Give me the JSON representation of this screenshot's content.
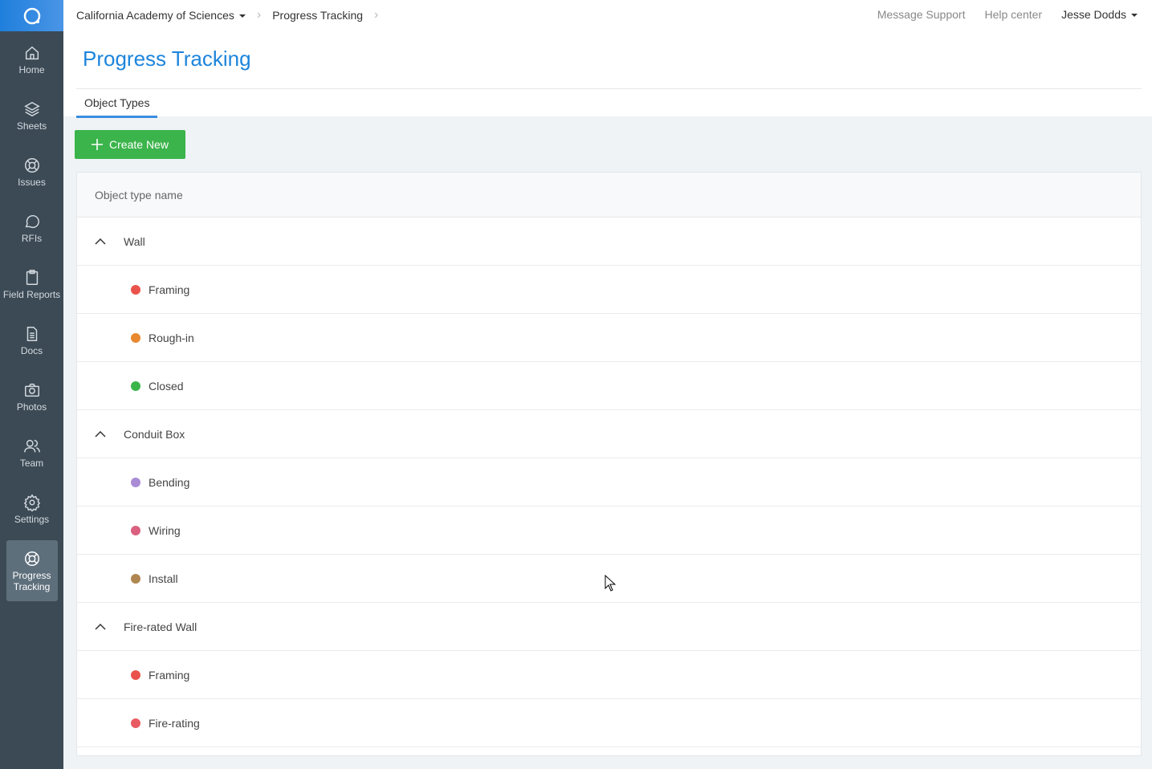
{
  "sidebar": {
    "items": [
      {
        "label": "Home",
        "icon": "home-icon"
      },
      {
        "label": "Sheets",
        "icon": "layers-icon"
      },
      {
        "label": "Issues",
        "icon": "lifebuoy-icon"
      },
      {
        "label": "RFIs",
        "icon": "chat-icon"
      },
      {
        "label": "Field Reports",
        "icon": "clipboard-icon"
      },
      {
        "label": "Docs",
        "icon": "document-icon"
      },
      {
        "label": "Photos",
        "icon": "camera-icon"
      },
      {
        "label": "Team",
        "icon": "team-icon"
      },
      {
        "label": "Settings",
        "icon": "gear-icon"
      },
      {
        "label": "Progress Tracking",
        "icon": "lifebuoy-icon"
      }
    ]
  },
  "header": {
    "project": "California Academy of Sciences",
    "breadcrumb": "Progress Tracking",
    "message_support": "Message Support",
    "help_center": "Help center",
    "user": "Jesse Dodds"
  },
  "page": {
    "title": "Progress Tracking",
    "tab": "Object Types",
    "create_button": "Create New"
  },
  "table": {
    "column": "Object type name",
    "groups": [
      {
        "name": "Wall",
        "items": [
          {
            "name": "Framing",
            "color": "#e9534b"
          },
          {
            "name": "Rough-in",
            "color": "#e8892f"
          },
          {
            "name": "Closed",
            "color": "#3bb54a"
          }
        ]
      },
      {
        "name": "Conduit Box",
        "items": [
          {
            "name": "Bending",
            "color": "#a98bd6"
          },
          {
            "name": "Wiring",
            "color": "#d9607f"
          },
          {
            "name": "Install",
            "color": "#b08650"
          }
        ]
      },
      {
        "name": "Fire-rated Wall",
        "items": [
          {
            "name": "Framing",
            "color": "#e9534b"
          },
          {
            "name": "Fire-rating",
            "color": "#e85b62"
          }
        ]
      }
    ]
  }
}
